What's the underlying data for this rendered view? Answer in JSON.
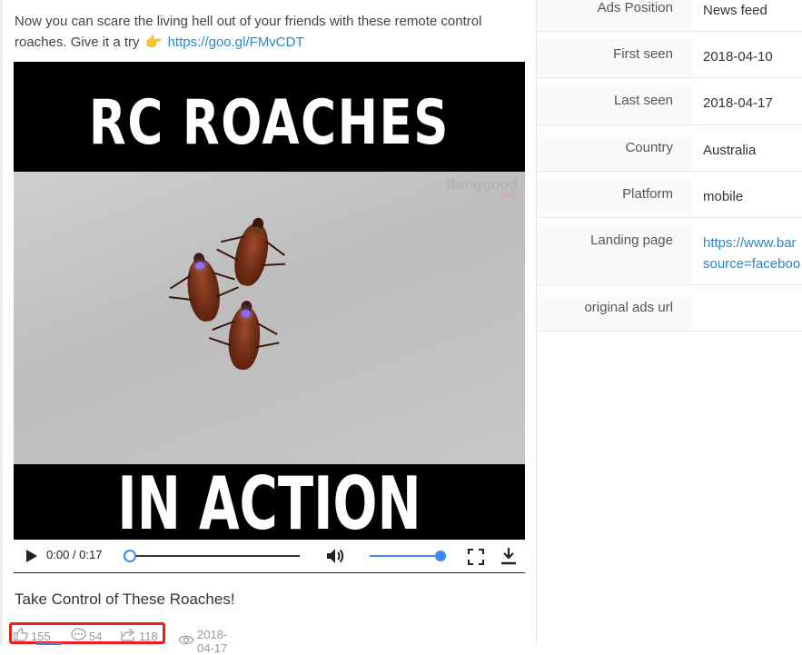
{
  "post": {
    "caption_text": "Now you can scare the living hell out of your friends with these remote control roaches. Give it a try",
    "caption_link": "https://goo.gl/FMvCDT",
    "video": {
      "top_text": "RC ROACHES",
      "bottom_text": "IN ACTION",
      "watermark": "Banggood",
      "watermark_sub": ".com",
      "time": "0:00 / 0:17",
      "volume_level": 1.0,
      "progress": 0.0
    },
    "ad_title": "Take Control of These Roaches!",
    "stats": {
      "likes": "155",
      "comments": "54",
      "shares": "118",
      "date": "2018-04-17"
    },
    "highlight_color": "#ee1c1c"
  },
  "details": {
    "rows": [
      {
        "label": "Ads Position",
        "value": "News feed"
      },
      {
        "label": "First seen",
        "value": "2018-04-10"
      },
      {
        "label": "Last seen",
        "value": "2018-04-17"
      },
      {
        "label": "Country",
        "value": "Australia"
      },
      {
        "label": "Platform",
        "value": "mobile"
      },
      {
        "label": "Landing page",
        "value_line1": "https://www.bar",
        "value_line2": "source=faceboo"
      },
      {
        "label": "original ads url",
        "value": ""
      }
    ]
  },
  "colors": {
    "link": "#2a86c9",
    "accent_blue": "#4285f4"
  }
}
